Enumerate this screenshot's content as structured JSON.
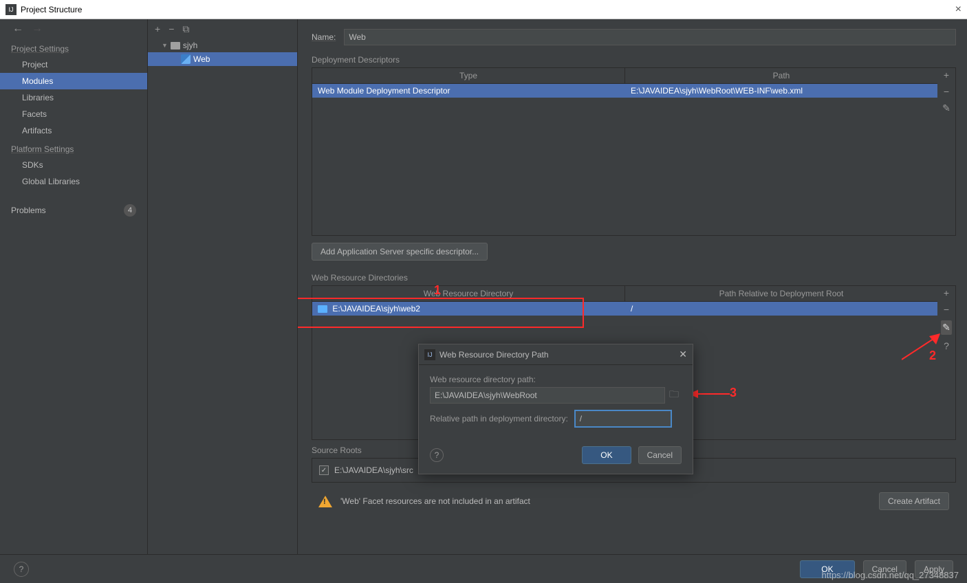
{
  "window": {
    "title": "Project Structure",
    "close": "×"
  },
  "sidebar": {
    "section1": "Project Settings",
    "items1": [
      "Project",
      "Modules",
      "Libraries",
      "Facets",
      "Artifacts"
    ],
    "section2": "Platform Settings",
    "items2": [
      "SDKs",
      "Global Libraries"
    ],
    "problems": "Problems",
    "problems_count": "4"
  },
  "tree": {
    "root": "sjyh",
    "child": "Web"
  },
  "form": {
    "name_label": "Name:",
    "name_value": "Web",
    "dd_title": "Deployment Descriptors",
    "dd_headers": [
      "Type",
      "Path"
    ],
    "dd_row": {
      "type": "Web Module Deployment Descriptor",
      "path": "E:\\JAVAIDEA\\sjyh\\WebRoot\\WEB-INF\\web.xml"
    },
    "add_descriptor_btn": "Add Application Server specific descriptor...",
    "wr_title": "Web Resource Directories",
    "wr_headers": [
      "Web Resource Directory",
      "Path Relative to Deployment Root"
    ],
    "wr_row": {
      "dir": "E:\\JAVAIDEA\\sjyh\\web2",
      "path": "/"
    },
    "sr_title": "Source Roots",
    "sr_row": "E:\\JAVAIDEA\\sjyh\\src",
    "warn": "'Web' Facet resources are not included in an artifact",
    "create_artifact": "Create Artifact"
  },
  "dialog": {
    "title": "Web Resource Directory Path",
    "path_label": "Web resource directory path:",
    "path_value": "E:\\JAVAIDEA\\sjyh\\WebRoot",
    "rel_label": "Relative path in deployment directory:",
    "rel_value": "/",
    "ok": "OK",
    "cancel": "Cancel"
  },
  "footer": {
    "ok": "OK",
    "cancel": "Cancel",
    "apply": "Apply"
  },
  "annotations": {
    "a1": "1",
    "a2": "2",
    "a3": "3"
  },
  "watermark": "https://blog.csdn.net/qq_27348837"
}
